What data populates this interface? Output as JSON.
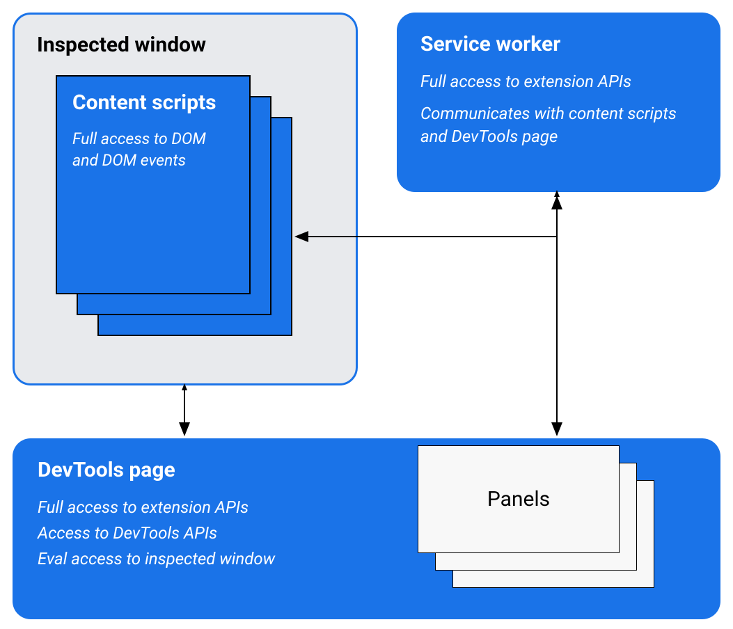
{
  "inspected_window": {
    "title": "Inspected window",
    "content_scripts": {
      "title": "Content scripts",
      "desc": "Full access to DOM and DOM events"
    }
  },
  "service_worker": {
    "title": "Service worker",
    "line1": "Full access to extension APIs",
    "line2": "Communicates with content scripts and DevTools page"
  },
  "devtools_page": {
    "title": "DevTools page",
    "line1": "Full access to extension APIs",
    "line2": "Access to DevTools APIs",
    "line3": "Eval access to inspected window",
    "panels": "Panels"
  }
}
